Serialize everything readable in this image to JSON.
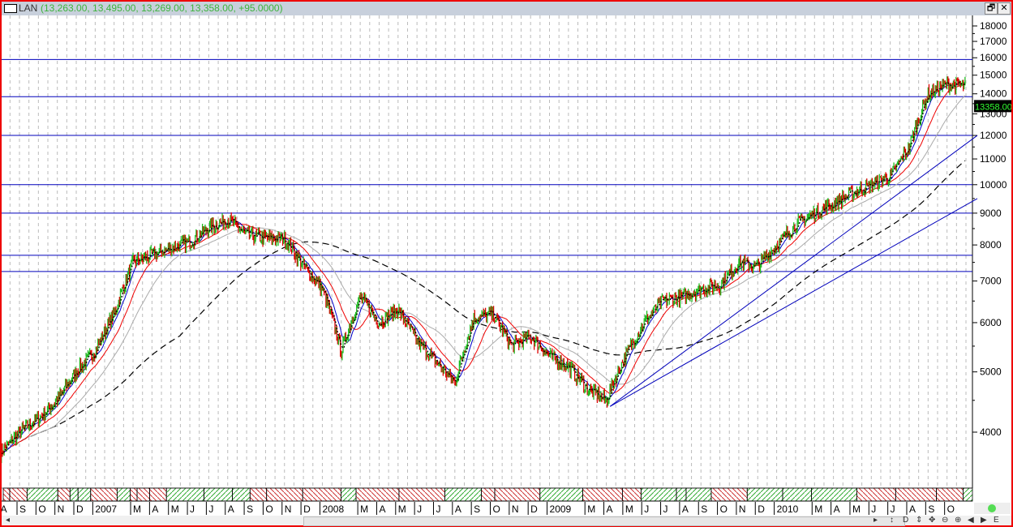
{
  "window": {
    "symbol": "LAN",
    "ohlc_text": "(13,263.00, 13,495.00, 13,269.00, 13,358.00, +95.0000)",
    "restore_label": "🗗",
    "close_label": "✕"
  },
  "price_label": "13358.00",
  "colors": {
    "up": "#22bb22",
    "down": "#dd0000",
    "hline": "#0000bb",
    "frame": "#ee0000"
  },
  "scroll": {
    "left": "◂",
    "right": "▸",
    "tools": [
      "↕",
      "D",
      "⇕",
      "✥",
      "⊖",
      "⊕",
      "◀",
      "▶",
      "E"
    ]
  },
  "chart_data": {
    "type": "candlestick",
    "y_scale": "log",
    "ylim": [
      3600,
      18500
    ],
    "y_ticks": [
      4000,
      5000,
      6000,
      7000,
      8000,
      9000,
      10000,
      11000,
      12000,
      13000,
      14000,
      15000,
      16000,
      17000,
      18000
    ],
    "x_labels": [
      "A",
      "S",
      "O",
      "N",
      "D",
      "2007",
      "M",
      "A",
      "M",
      "J",
      "J",
      "A",
      "S",
      "O",
      "N",
      "D",
      "2008",
      "M",
      "A",
      "M",
      "J",
      "J",
      "A",
      "S",
      "O",
      "N",
      "D",
      "2009",
      "M",
      "A",
      "M",
      "J",
      "J",
      "A",
      "S",
      "O",
      "N",
      "D",
      "2010",
      "M",
      "A",
      "M",
      "J",
      "J",
      "A",
      "S",
      "O"
    ],
    "x_label_months": [
      0,
      1,
      2,
      3,
      4,
      5,
      7,
      8,
      9,
      10,
      11,
      12,
      13,
      14,
      15,
      16,
      17,
      19,
      20,
      21,
      22,
      23,
      24,
      25,
      26,
      27,
      28,
      29,
      31,
      32,
      33,
      34,
      35,
      36,
      37,
      38,
      39,
      40,
      41,
      43,
      44,
      45,
      46,
      47,
      48,
      49,
      50
    ],
    "monthly_close": [
      3700,
      4000,
      4200,
      4500,
      5000,
      5400,
      6200,
      7500,
      7700,
      7900,
      8100,
      8500,
      8800,
      8300,
      8200,
      8200,
      7400,
      6800,
      5400,
      6600,
      6000,
      6300,
      5600,
      5200,
      4800,
      6100,
      6200,
      5500,
      5700,
      5300,
      5100,
      4700,
      4500,
      5300,
      6000,
      6500,
      6600,
      6800,
      6900,
      7500,
      7400,
      8000,
      8600,
      9000,
      9300,
      9700,
      10000,
      10300,
      11500,
      14000,
      14500,
      14400
    ],
    "horizontal_lines": [
      15900,
      13850,
      12000,
      10000,
      9000,
      7700,
      7250
    ],
    "trend_lines": [
      {
        "from": [
          32.2,
          4400
        ],
        "to": [
          51.6,
          12000
        ]
      },
      {
        "from": [
          32.2,
          4400
        ],
        "to": [
          51.6,
          9500
        ]
      }
    ]
  }
}
